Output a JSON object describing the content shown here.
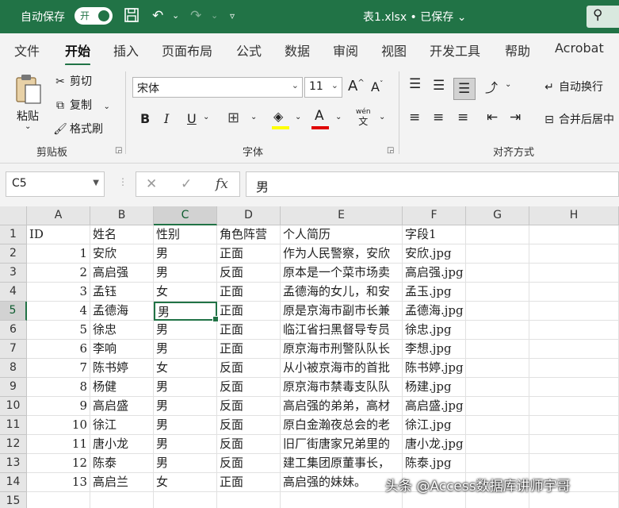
{
  "titlebar": {
    "autosave_label": "自动保存",
    "autosave_toggle": "开",
    "filename": "表1.xlsx • 已保存 ⌄"
  },
  "tabs": [
    "文件",
    "开始",
    "插入",
    "页面布局",
    "公式",
    "数据",
    "审阅",
    "视图",
    "开发工具",
    "帮助",
    "Acrobat"
  ],
  "ribbon": {
    "clipboard": {
      "paste": "粘贴",
      "cut": "剪切",
      "copy": "复制",
      "format_painter": "格式刷",
      "group_label": "剪贴板"
    },
    "font": {
      "font_name": "宋体",
      "font_size": "11",
      "bold": "B",
      "italic": "I",
      "underline": "U",
      "phonetic": "wén",
      "group_label": "字体"
    },
    "alignment": {
      "wrap_text": "自动换行",
      "merge_center": "合并后居中",
      "group_label": "对齐方式"
    },
    "colors": {
      "accent": "#217346",
      "highlight": "#ffff00",
      "font_color": "#e00000"
    }
  },
  "formula_bar": {
    "name_box": "C5",
    "cancel_icon": "✕",
    "enter_icon": "✓",
    "fx": "fx",
    "formula": "男"
  },
  "sheet": {
    "columns": [
      "A",
      "B",
      "C",
      "D",
      "E",
      "F",
      "G",
      "H"
    ],
    "row_numbers": [
      "1",
      "2",
      "3",
      "4",
      "5",
      "6",
      "7",
      "8",
      "9",
      "10",
      "11",
      "12",
      "13",
      "14",
      "15"
    ],
    "active_cell": "C5",
    "rows": [
      [
        "ID",
        "姓名",
        "性别",
        "角色阵营",
        "个人简历",
        "字段1"
      ],
      [
        "1",
        "安欣",
        "男",
        "正面",
        "作为人民警察，安欣",
        "安欣.jpg"
      ],
      [
        "2",
        "高启强",
        "男",
        "反面",
        "原本是一个菜市场卖",
        "高启强.jpg"
      ],
      [
        "3",
        "孟钰",
        "女",
        "正面",
        "孟德海的女儿，和安",
        "孟玉.jpg"
      ],
      [
        "4",
        "孟德海",
        "男",
        "正面",
        "原是京海市副市长兼",
        "孟德海.jpg"
      ],
      [
        "5",
        "徐忠",
        "男",
        "正面",
        "临江省扫黑督导专员",
        "徐忠.jpg"
      ],
      [
        "6",
        "李响",
        "男",
        "正面",
        "原京海市刑警队队长",
        "李想.jpg"
      ],
      [
        "7",
        "陈书婷",
        "女",
        "反面",
        "从小被京海市的首批",
        "陈书婷.jpg"
      ],
      [
        "8",
        "杨健",
        "男",
        "反面",
        "原京海市禁毒支队队",
        "杨建.jpg"
      ],
      [
        "9",
        "高启盛",
        "男",
        "反面",
        "高启强的弟弟，高材",
        "高启盛.jpg"
      ],
      [
        "10",
        "徐江",
        "男",
        "反面",
        "原白金瀚夜总会的老",
        "徐江.jpg"
      ],
      [
        "11",
        "唐小龙",
        "男",
        "反面",
        "旧厂街唐家兄弟里的",
        "唐小龙.jpg"
      ],
      [
        "12",
        "陈泰",
        "男",
        "反面",
        "建工集团原董事长，",
        "陈泰.jpg"
      ],
      [
        "13",
        "高启兰",
        "女",
        "正面",
        "高启强的妹妹。",
        ""
      ],
      [
        "",
        "",
        "",
        "",
        "",
        ""
      ]
    ]
  },
  "watermark": "头条 @Access数据库讲师宇哥"
}
